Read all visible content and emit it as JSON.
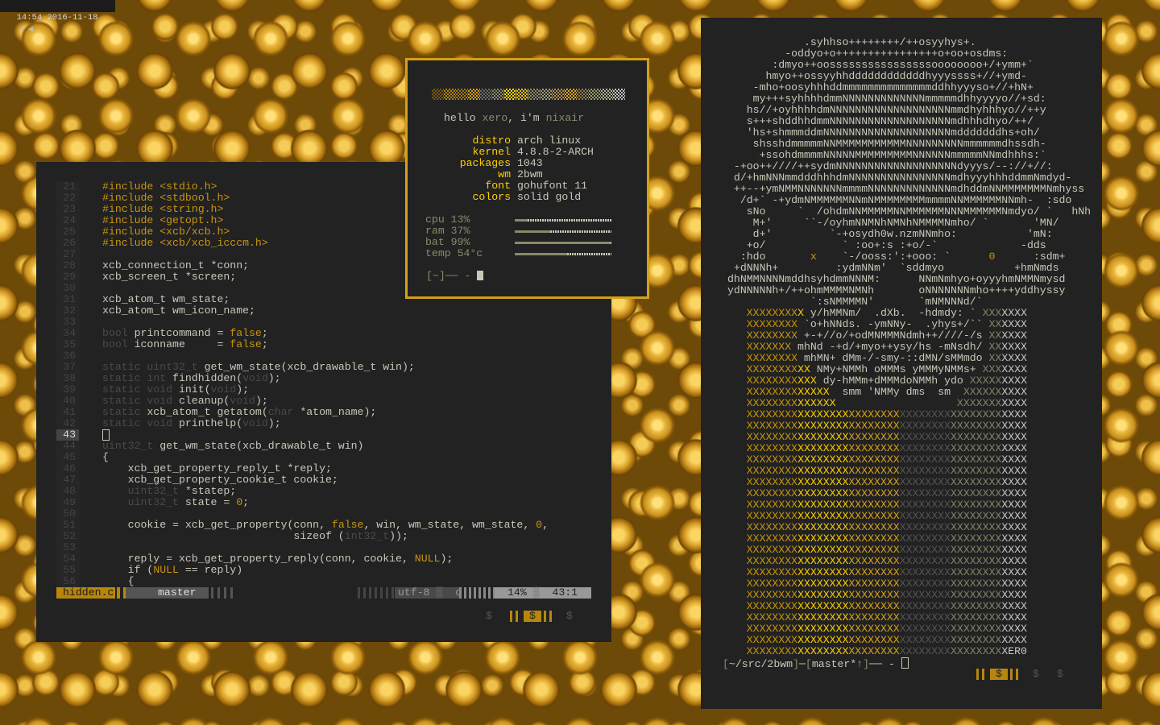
{
  "topbar": {
    "time": "14:54",
    "date": "2016-11-18",
    "icons": [
      "pin-icon",
      "speaker-icon"
    ]
  },
  "colors": {
    "gold": "#d4a017",
    "dark_gold": "#b8860b",
    "bg": "#222222",
    "fg": "#c8c8b8",
    "dim": "#4a4a4a"
  },
  "editor": {
    "current_line": 43,
    "lines": [
      {
        "n": "21",
        "s": [
          [
            "g",
            "#include <stdio.h>"
          ]
        ]
      },
      {
        "n": "22",
        "s": [
          [
            "g",
            "#include <stdbool.h>"
          ]
        ]
      },
      {
        "n": "23",
        "s": [
          [
            "g",
            "#include <string.h>"
          ]
        ]
      },
      {
        "n": "24",
        "s": [
          [
            "g",
            "#include <getopt.h>"
          ]
        ]
      },
      {
        "n": "25",
        "s": [
          [
            "g",
            "#include <xcb/xcb.h>"
          ]
        ]
      },
      {
        "n": "26",
        "s": [
          [
            "g",
            "#include <xcb/xcb_icccm.h>"
          ]
        ]
      },
      {
        "n": "27",
        "s": []
      },
      {
        "n": "28",
        "s": [
          [
            "n",
            "xcb_connection_t *conn;"
          ]
        ]
      },
      {
        "n": "29",
        "s": [
          [
            "n",
            "xcb_screen_t *screen;"
          ]
        ]
      },
      {
        "n": "30",
        "s": []
      },
      {
        "n": "31",
        "s": [
          [
            "n",
            "xcb_atom_t wm_state;"
          ]
        ]
      },
      {
        "n": "32",
        "s": [
          [
            "n",
            "xcb_atom_t wm_icon_name;"
          ]
        ]
      },
      {
        "n": "33",
        "s": []
      },
      {
        "n": "34",
        "s": [
          [
            "t",
            "bool"
          ],
          [
            "n",
            " printcommand = "
          ],
          [
            "g",
            "false"
          ],
          [
            "n",
            ";"
          ]
        ]
      },
      {
        "n": "35",
        "s": [
          [
            "t",
            "bool"
          ],
          [
            "n",
            " iconname     = "
          ],
          [
            "g",
            "false"
          ],
          [
            "n",
            ";"
          ]
        ]
      },
      {
        "n": "36",
        "s": []
      },
      {
        "n": "37",
        "s": [
          [
            "t",
            "static uint32_t"
          ],
          [
            "n",
            " get_wm_state(xcb_drawable_t win);"
          ]
        ]
      },
      {
        "n": "38",
        "s": [
          [
            "t",
            "static int"
          ],
          [
            "n",
            " findhidden("
          ],
          [
            "t",
            "void"
          ],
          [
            "n",
            ");"
          ]
        ]
      },
      {
        "n": "39",
        "s": [
          [
            "t",
            "static void"
          ],
          [
            "n",
            " init("
          ],
          [
            "t",
            "void"
          ],
          [
            "n",
            ");"
          ]
        ]
      },
      {
        "n": "40",
        "s": [
          [
            "t",
            "static void"
          ],
          [
            "n",
            " cleanup("
          ],
          [
            "t",
            "void"
          ],
          [
            "n",
            ");"
          ]
        ]
      },
      {
        "n": "41",
        "s": [
          [
            "t",
            "static"
          ],
          [
            "n",
            " xcb_atom_t getatom("
          ],
          [
            "t",
            "char"
          ],
          [
            "n",
            " *atom_name);"
          ]
        ]
      },
      {
        "n": "42",
        "s": [
          [
            "t",
            "static void"
          ],
          [
            "n",
            " printhelp("
          ],
          [
            "t",
            "void"
          ],
          [
            "n",
            ");"
          ]
        ]
      },
      {
        "n": "43",
        "s": []
      },
      {
        "n": "44",
        "s": [
          [
            "t",
            "uint32_t"
          ],
          [
            "n",
            " get_wm_state(xcb_drawable_t win)"
          ]
        ]
      },
      {
        "n": "45",
        "s": [
          [
            "n",
            "{"
          ]
        ]
      },
      {
        "n": "46",
        "s": [
          [
            "n",
            "    xcb_get_property_reply_t *reply;"
          ]
        ]
      },
      {
        "n": "47",
        "s": [
          [
            "n",
            "    xcb_get_property_cookie_t cookie;"
          ]
        ]
      },
      {
        "n": "48",
        "s": [
          [
            "n",
            "    "
          ],
          [
            "t",
            "uint32_t"
          ],
          [
            "n",
            " *statep;"
          ]
        ]
      },
      {
        "n": "49",
        "s": [
          [
            "n",
            "    "
          ],
          [
            "t",
            "uint32_t"
          ],
          [
            "n",
            " state = "
          ],
          [
            "g",
            "0"
          ],
          [
            "n",
            ";"
          ]
        ]
      },
      {
        "n": "50",
        "s": []
      },
      {
        "n": "51",
        "s": [
          [
            "n",
            "    cookie = xcb_get_property(conn, "
          ],
          [
            "g",
            "false"
          ],
          [
            "n",
            ", win, wm_state, wm_state, "
          ],
          [
            "g",
            "0"
          ],
          [
            "n",
            ","
          ]
        ]
      },
      {
        "n": "52",
        "s": [
          [
            "n",
            "                              sizeof ("
          ],
          [
            "t",
            "int32_t"
          ],
          [
            "n",
            "));"
          ]
        ]
      },
      {
        "n": "53",
        "s": []
      },
      {
        "n": "54",
        "s": [
          [
            "n",
            "    reply = xcb_get_property_reply(conn, cookie, "
          ],
          [
            "g",
            "NULL"
          ],
          [
            "n",
            ");"
          ]
        ]
      },
      {
        "n": "55",
        "s": [
          [
            "n",
            "    if ("
          ],
          [
            "g",
            "NULL"
          ],
          [
            "n",
            " == reply)"
          ]
        ]
      },
      {
        "n": "56",
        "s": [
          [
            "n",
            "    {"
          ]
        ]
      }
    ],
    "statusline": {
      "filename": "hidden.c",
      "branch": "master",
      "encoding": "utf-8",
      "filetype": "c",
      "percent": "14%",
      "position": "43:1"
    },
    "workspaces": [
      "$",
      "$",
      "$"
    ],
    "active_workspace": 1
  },
  "info": {
    "greeting": {
      "hello": "hello ",
      "user": "xero",
      "mid": ", i'm ",
      "host": "nixair"
    },
    "palette": [
      "#7a5a10",
      "#b8860b",
      "#a07818",
      "#d4a017",
      "#6a6a6a",
      "#8a8a6a",
      "#ffd700",
      "#e8c020",
      "#8a8a6a",
      "#9a9a7a",
      "#b09048",
      "#daa520",
      "#8a7a50",
      "#9a9a6a",
      "#b0b090",
      "#c0c0c0"
    ],
    "fields": [
      {
        "label": "distro",
        "value": "arch linux"
      },
      {
        "label": "kernel",
        "value": "4.8.8-2-ARCH"
      },
      {
        "label": "packages",
        "value": "1043"
      },
      {
        "label": "wm",
        "value": "2bwm"
      },
      {
        "label": "font",
        "value": "gohufont 11"
      },
      {
        "label": "colors",
        "value": "solid gold"
      }
    ],
    "stats": [
      {
        "label": "cpu",
        "value": "13%",
        "fraction": 0.13
      },
      {
        "label": "ram",
        "value": "37%",
        "fraction": 0.37
      },
      {
        "label": "bat",
        "value": "99%",
        "fraction": 0.99
      },
      {
        "label": "temp",
        "value": "54°c",
        "fraction": 0.54
      }
    ],
    "prompt": "[~]── - "
  },
  "terminal": {
    "palette_colors": [
      "#c8960c",
      "#ffd000",
      "#d9a21a",
      "#555555",
      "#85856a",
      "#c8c8c8"
    ],
    "accent_chars_color": "#c89510",
    "art": [
      "            .syhhso++++++++/++osyyhys+.",
      "         -oddyo+o++++++++++++++++o+oo+osdms:",
      "       :dmyo++oossssssssssssssssoooooooo+/+ymm+`",
      "      hmyo++ossyyhhddddddddddddhyyyssss+//+ymd-",
      "    -mho+oosyhhhddmmmmmmmmmmmmmmddhhyyyso+//+hN+",
      "    my+++syhhhhdmmNNNNNNNNNNNNNmmmmmdhhyyyyo//+sd:",
      "   hs//+oyhhhhdmNNNNNNNNNNNNNNNNNNNmmdhyhhhyo//++y",
      "   s+++shddhhdmmNNNNNNNNNNNNNNNNNNNmdhhhdhyo/++/",
      "   'hs+shmmmddmNNNNNNNNNNNNNNNNNNNNmdddddddhs+oh/",
      "    shsshdmmmmmNNMMMMMMMMMMMNNNNNNNNNmmmmmmdhssdh-",
      "     +ssohdmmmmNNNNNMMMMMMMMMNNNNNNmmmmmNNmdhhhs:`",
      " -+oo++////++sydmNNNNNNNNNNNNNNNNNNNdyyys/--://+//:",
      " d/+hmNNNmmdddhhhdmNNNNNNNNNNNNNNNNmdhyyyhhhddmmNmdyd-",
      " ++--+ymNMMNNNNNNNmmmmNNNNNNNNNNNNNmdhddmNNMMMMMMMNmhyss",
      "  /d+` -+ydmNMMMMMMNNmNMMMMMMMMmmmmNNMMMMMMNNmh-  :sdo",
      "   sNo     `  /ohdmNNMMMMMNNMMMMMMNNNMMMMMMNmdyo/ `   hNh",
      "    M+'     ``-/oyhmNNMNhNMNhNMMMMNmho/ `       'MN/",
      "    d+'         `-+osydh0w.nzmNNmho:           'mN:",
      "   +o/            ` :oo+:s :+o/-`             -dds",
      "  :hdo       x    `-/ooss:':+ooo: `      0      :sdm+",
      " +dNNNh+         :ydmNNm'  `sddmyo           +hmNmds",
      "dhNMMNNNNmddhsyhdmmNNNM:      NNmNmhyo+oyyyhmNMMNmysd",
      "ydNNNNNh+/++ohmMMMMNMNh       oNNNNNNNmho++++yddhyssy",
      "             `:sNMMMMN'       `mNMNNNd/`",
      "   XXXXXXXXX y/hMMNm/  .dXb.  -hdmdy: ` XXXXXXX",
      "   XXXXXXXX `o+hNNds. -ymNNy-  .yhys+/`` XXXXXX",
      "   XXXXXXXX +-+//o/+odMNMMMNdmh++////-/s XXXXXX",
      "   XXXXXXX mhNd -+d/+myo++ysy/hs -mNsdh/ XXXXXX",
      "   XXXXXXXX mhMN+ dMm-/-smy-::dMN/sMMmdo XXXXXX",
      "   XXXXXXXXXX NMy+NMMh oMMMs yMMMyNMMs+ XXXXXXX",
      "   XXXXXXXXXXX dy-hMMm+dMMMdoNMMh ydo XXXXXXXXX",
      "   XXXXXXXXXXXXX  smm 'NMMy dms  sm  XXXXXXXXXX",
      "   XXXXXXXXXXXXXX                   XXXXXXXXXXX",
      "   XXXXXXXXXXXXXXXXXXXXXXXXXXXXXXXXXXXXXXXXXXXX",
      "   XXXXXXXXXXXXXXXXXXXXXXXXXXXXXXXXXXXXXXXXXXXX",
      "   XXXXXXXXXXXXXXXXXXXXXXXXXXXXXXXXXXXXXXXXXXXX",
      "   XXXXXXXXXXXXXXXXXXXXXXXXXXXXXXXXXXXXXXXXXXXX",
      "   XXXXXXXXXXXXXXXXXXXXXXXXXXXXXXXXXXXXXXXXXXXX",
      "   XXXXXXXXXXXXXXXXXXXXXXXXXXXXXXXXXXXXXXXXXXXX",
      "   XXXXXXXXXXXXXXXXXXXXXXXXXXXXXXXXXXXXXXXXXXXX",
      "   XXXXXXXXXXXXXXXXXXXXXXXXXXXXXXXXXXXXXXXXXXXX",
      "   XXXXXXXXXXXXXXXXXXXXXXXXXXXXXXXXXXXXXXXXXXXX",
      "   XXXXXXXXXXXXXXXXXXXXXXXXXXXXXXXXXXXXXXXXXXXX",
      "   XXXXXXXXXXXXXXXXXXXXXXXXXXXXXXXXXXXXXXXXXXXX",
      "   XXXXXXXXXXXXXXXXXXXXXXXXXXXXXXXXXXXXXXXXXXXX",
      "   XXXXXXXXXXXXXXXXXXXXXXXXXXXXXXXXXXXXXXXXXXXX",
      "   XXXXXXXXXXXXXXXXXXXXXXXXXXXXXXXXXXXXXXXXXXXX",
      "   XXXXXXXXXXXXXXXXXXXXXXXXXXXXXXXXXXXXXXXXXXXX",
      "   XXXXXXXXXXXXXXXXXXXXXXXXXXXXXXXXXXXXXXXXXXXX",
      "   XXXXXXXXXXXXXXXXXXXXXXXXXXXXXXXXXXXXXXXXXXXX",
      "   XXXXXXXXXXXXXXXXXXXXXXXXXXXXXXXXXXXXXXXXXXXX",
      "   XXXXXXXXXXXXXXXXXXXXXXXXXXXXXXXXXXXXXXXXXXXX",
      "   XXXXXXXXXXXXXXXXXXXXXXXXXXXXXXXXXXXXXXXXXXXX",
      "   XXXXXXXXXXXXXXXXXXXXXXXXXXXXXXXXXXXXXXXXXXXX",
      "   XXXXXXXXXXXXXXXXXXXXXXXXXXXXXXXXXXXXXXXXXER0"
    ],
    "prompt": {
      "dir_open": "[",
      "dir": "~/src/2bwm",
      "dir_close": "]",
      "sep": "─",
      "git_open": "[",
      "branch": "master*",
      "ahead": "↑",
      "git_close": "]",
      "tail": "── - "
    },
    "workspaces": [
      "$",
      "$",
      "$"
    ],
    "active_workspace": 0
  }
}
